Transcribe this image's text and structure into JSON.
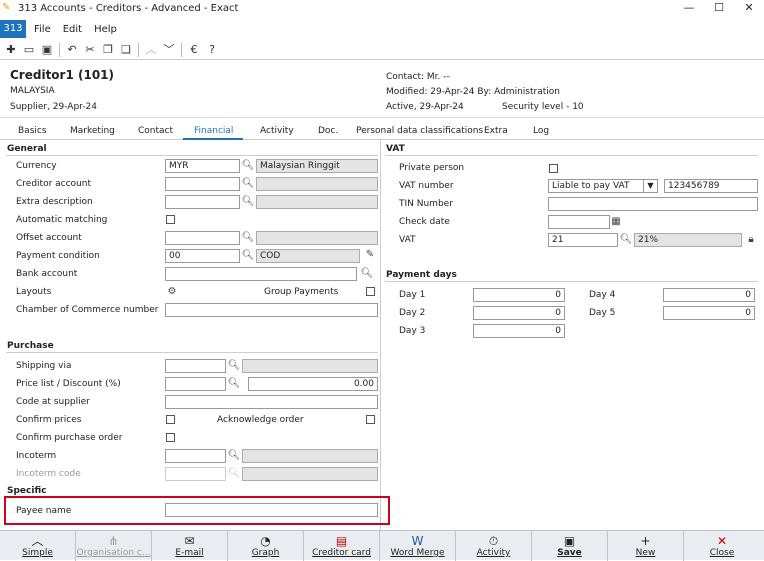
{
  "window": {
    "title": "313 Accounts - Creditors - Advanced - Exact",
    "minimize": "—",
    "maximize": "☐",
    "close": "✕"
  },
  "menu": {
    "badge": "313",
    "items": [
      "File",
      "Edit",
      "Help"
    ]
  },
  "header": {
    "name": "Creditor1 (101)",
    "country": "MALAYSIA",
    "supplier": "Supplier, 29-Apr-24",
    "contact": "Contact: Mr. --",
    "modified": "Modified: 29-Apr-24  By: Administration",
    "active": "Active, 29-Apr-24",
    "security": "Security level - 10"
  },
  "tabs": [
    "Basics",
    "Marketing",
    "Contact",
    "Financial",
    "Activity",
    "Doc.",
    "Personal data classifications",
    "Extra",
    "Log"
  ],
  "general": {
    "title": "General",
    "currency_label": "Currency",
    "currency_code": "MYR",
    "currency_name": "Malaysian Ringgit",
    "creditor_account_label": "Creditor account",
    "extra_description_label": "Extra description",
    "automatic_matching_label": "Automatic matching",
    "offset_account_label": "Offset account",
    "payment_condition_label": "Payment condition",
    "payment_condition_code": "00",
    "payment_condition_name": "COD",
    "bank_account_label": "Bank account",
    "layouts_label": "Layouts",
    "group_payments_label": "Group Payments",
    "chamber_label": "Chamber of Commerce number"
  },
  "purchase": {
    "title": "Purchase",
    "shipping_via_label": "Shipping via",
    "price_list_label": "Price list / Discount (%)",
    "discount_value": "0.00",
    "code_at_supplier_label": "Code at supplier",
    "confirm_prices_label": "Confirm prices",
    "acknowledge_order_label": "Acknowledge order",
    "confirm_purchase_order_label": "Confirm purchase order",
    "incoterm_label": "Incoterm",
    "incoterm_code_label": "Incoterm code"
  },
  "specific": {
    "title": "Specific",
    "payee_name_label": "Payee name"
  },
  "vat": {
    "title": "VAT",
    "private_person_label": "Private person",
    "vat_number_label": "VAT number",
    "vat_type": "Liable to pay VAT",
    "vat_number": "123456789",
    "tin_label": "TIN Number",
    "check_date_label": "Check date",
    "vat_label": "VAT",
    "vat_code": "21",
    "vat_rate": "21%"
  },
  "payment_days": {
    "title": "Payment days",
    "day1_label": "Day 1",
    "day1": "0",
    "day2_label": "Day 2",
    "day2": "0",
    "day3_label": "Day 3",
    "day3": "0",
    "day4_label": "Day 4",
    "day4": "0",
    "day5_label": "Day 5",
    "day5": "0"
  },
  "buttons": [
    "Simple",
    "Organisation c...",
    "E-mail",
    "Graph",
    "Creditor card",
    "Word Merge",
    "Activity",
    "Save",
    "New",
    "Close"
  ]
}
